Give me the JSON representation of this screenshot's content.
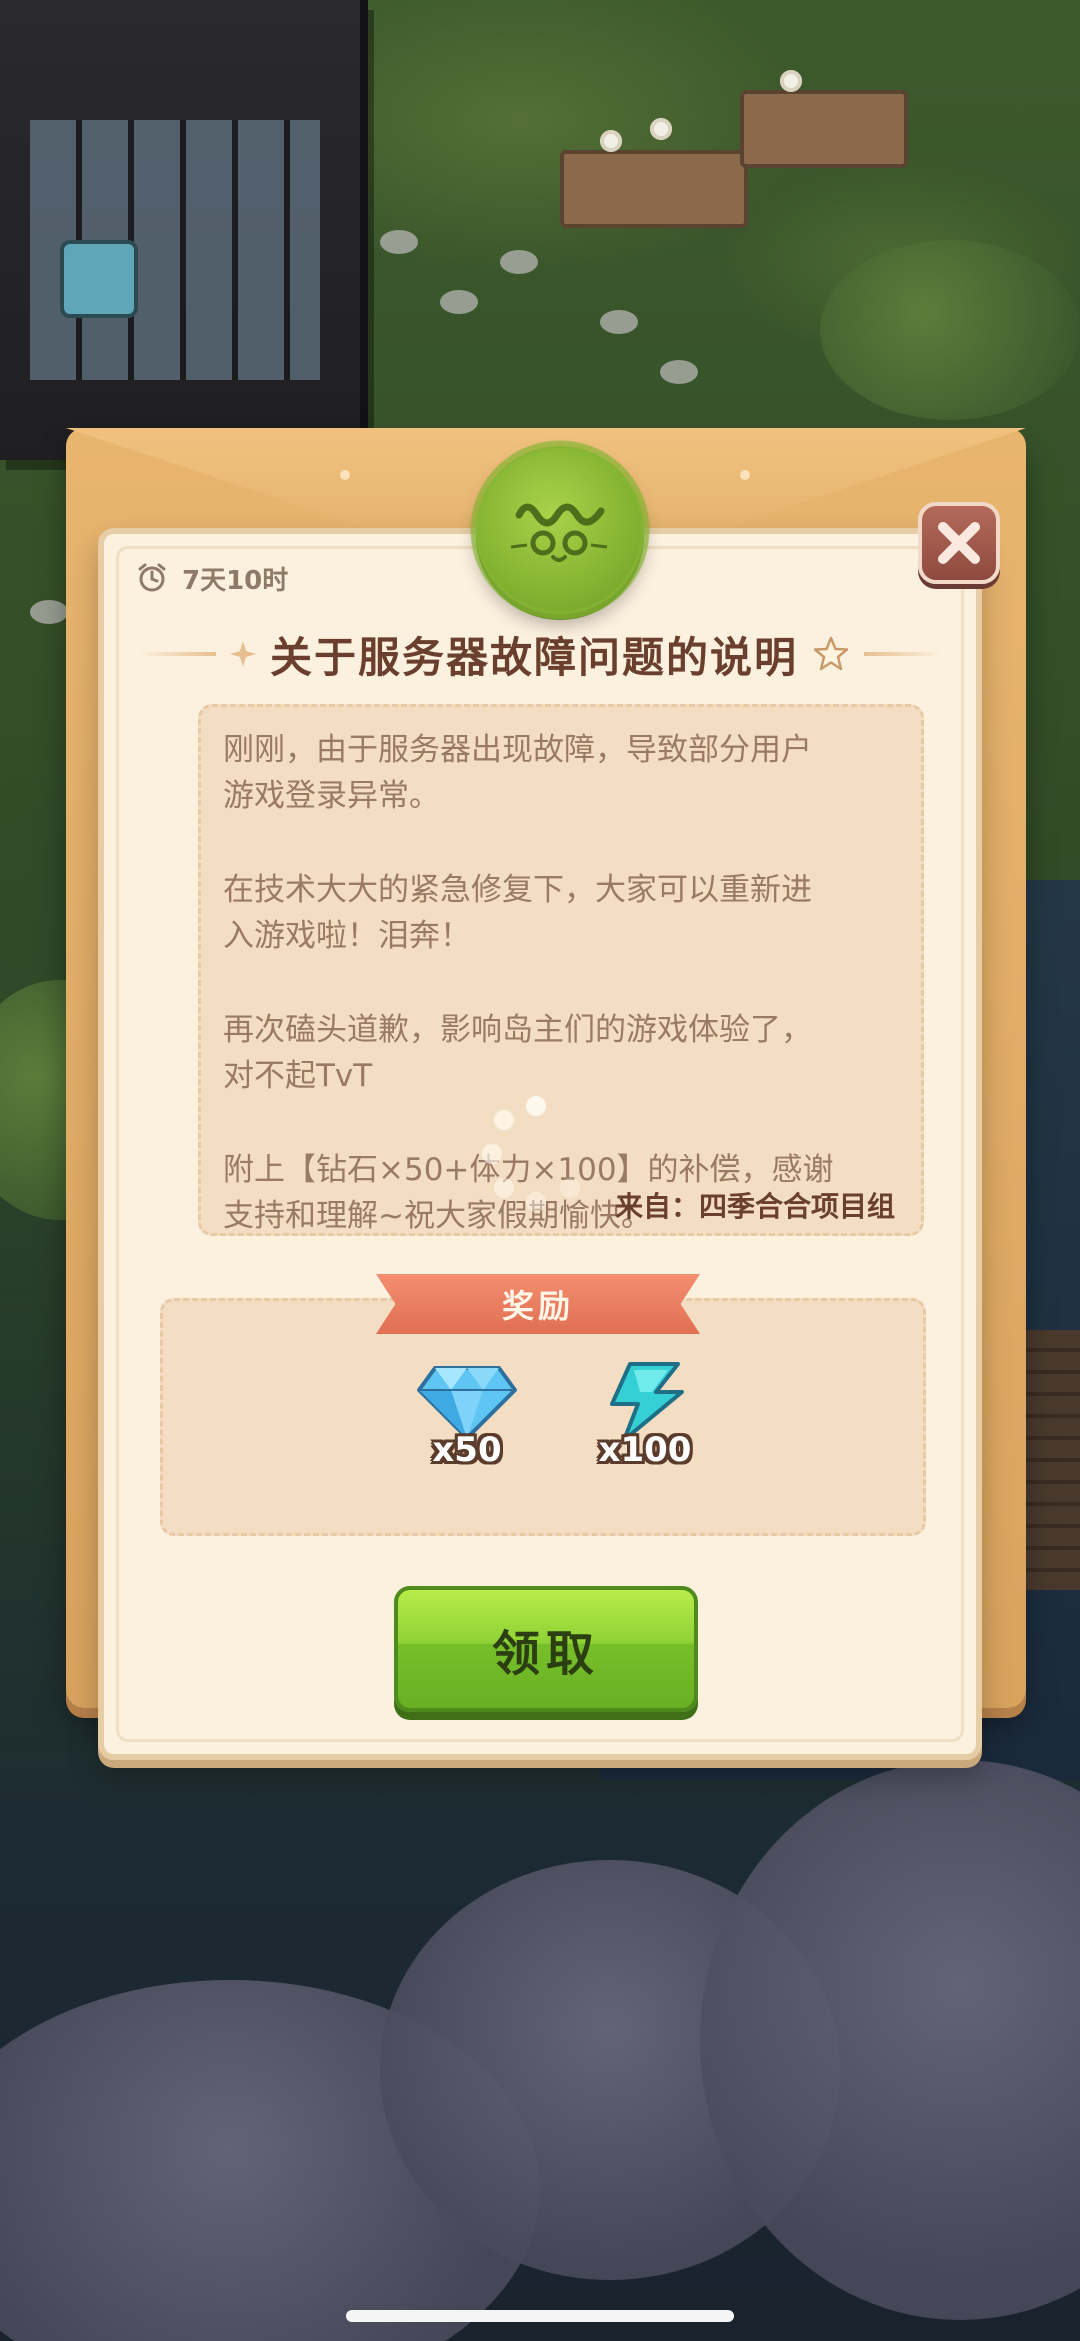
{
  "notice": {
    "timer": "7天10时",
    "title": "关于服务器故障问题的说明",
    "paragraphs": [
      "刚刚，由于服务器出现故障，导致部分用户\n游戏登录异常。",
      "在技术大大的紧急修复下，大家可以重新进\n入游戏啦！泪奔！",
      "再次磕头道歉，影响岛主们的游戏体验了，\n对不起TvT",
      "附上【钻石×50+体力×100】的补偿，感谢\n支持和理解~祝大家假期愉快。"
    ],
    "from": "来自：四季合合项目组"
  },
  "rewards": {
    "label": "奖励",
    "items": [
      {
        "icon": "diamond-icon",
        "count": "x50"
      },
      {
        "icon": "energy-bolt-icon",
        "count": "x100"
      }
    ]
  },
  "claim_button": "领取",
  "colors": {
    "title": "#6a3f2d",
    "body_text": "#9a7a63",
    "ribbon": "#e06f53",
    "claim_green": "#8fd235",
    "seal_green": "#86b533"
  }
}
